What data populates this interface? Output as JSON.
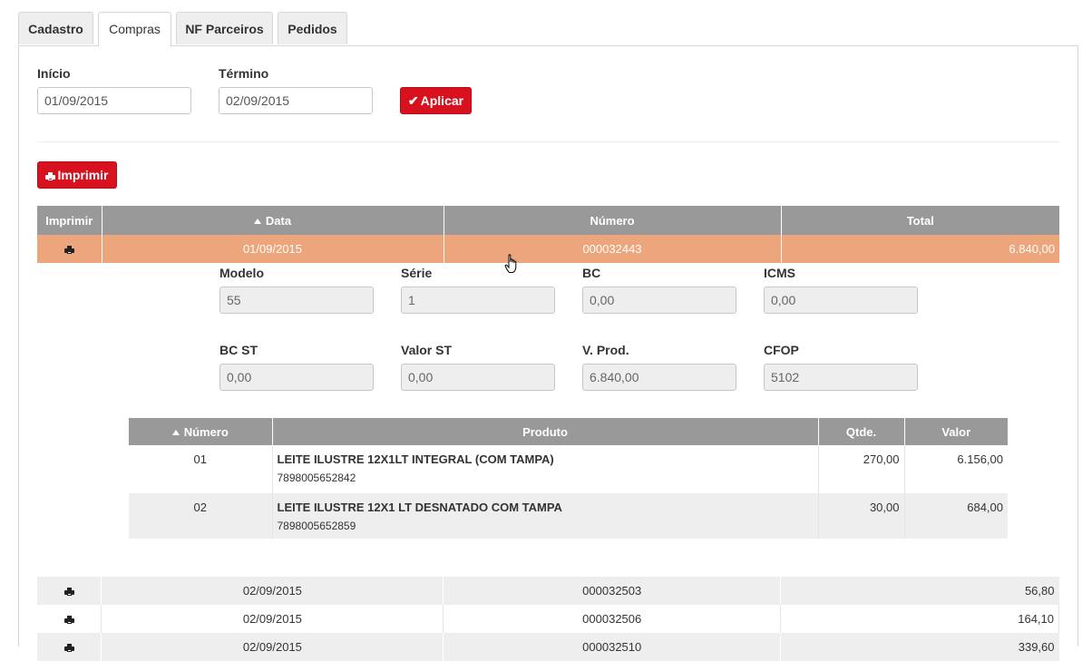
{
  "tabs": [
    {
      "label": "Cadastro",
      "active": false
    },
    {
      "label": "Compras",
      "active": true
    },
    {
      "label": "NF Parceiros",
      "active": false
    },
    {
      "label": "Pedidos",
      "active": false
    }
  ],
  "filters": {
    "start_label": "Início",
    "start_value": "01/09/2015",
    "end_label": "Término",
    "end_value": "02/09/2015",
    "apply_label": "Aplicar"
  },
  "print_button_label": "Imprimir",
  "main_table": {
    "headers": {
      "print": "Imprimir",
      "date": "Data",
      "number": "Número",
      "total": "Total"
    },
    "selected_row": {
      "date": "01/09/2015",
      "number": "000032443",
      "total": "6.840,00"
    },
    "rows": [
      {
        "date": "02/09/2015",
        "number": "000032503",
        "total": "56,80"
      },
      {
        "date": "02/09/2015",
        "number": "000032506",
        "total": "164,10"
      },
      {
        "date": "02/09/2015",
        "number": "000032510",
        "total": "339,60"
      }
    ]
  },
  "details": {
    "modelo_label": "Modelo",
    "modelo_value": "55",
    "serie_label": "Série",
    "serie_value": "1",
    "bc_label": "BC",
    "bc_value": "0,00",
    "icms_label": "ICMS",
    "icms_value": "0,00",
    "bcst_label": "BC ST",
    "bcst_value": "0,00",
    "valorst_label": "Valor ST",
    "valorst_value": "0,00",
    "vprod_label": "V. Prod.",
    "vprod_value": "6.840,00",
    "cfop_label": "CFOP",
    "cfop_value": "5102"
  },
  "items_table": {
    "headers": {
      "number": "Número",
      "product": "Produto",
      "qty": "Qtde.",
      "value": "Valor"
    },
    "rows": [
      {
        "number": "01",
        "product": "LEITE ILUSTRE 12X1LT INTEGRAL (COM TAMPA)",
        "code": "7898005652842",
        "qty": "270,00",
        "value": "6.156,00"
      },
      {
        "number": "02",
        "product": "LEITE ILUSTRE 12X1 LT DESNATADO COM TAMPA",
        "code": "7898005652859",
        "qty": "30,00",
        "value": "684,00"
      }
    ]
  },
  "colors": {
    "accent_red": "#d8111f",
    "selected_row": "#eda67c",
    "header_gray": "#999999"
  }
}
